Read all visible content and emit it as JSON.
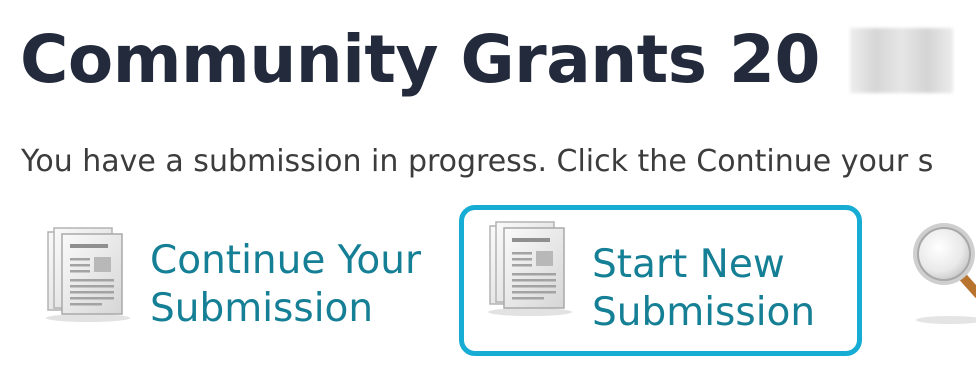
{
  "header": {
    "title": "Community Grants 20"
  },
  "intro": {
    "text": "You have a submission in progress. Click the Continue your s"
  },
  "actions": {
    "continue": {
      "line1": "Continue Your",
      "line2": "Submission",
      "icon": "document-stack-icon"
    },
    "start_new": {
      "line1": "Start New",
      "line2": "Submission",
      "icon": "document-stack-icon"
    },
    "search": {
      "icon": "magnifier-icon"
    }
  },
  "colors": {
    "title": "#222a3b",
    "body_text": "#3c3c3c",
    "link": "#157f95",
    "focus_border": "#16acd4"
  }
}
